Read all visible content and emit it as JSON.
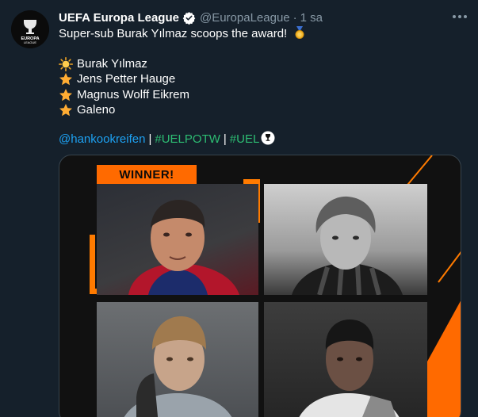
{
  "tweet": {
    "account_name": "UEFA Europa League",
    "handle": "@EuropaLeague",
    "separator": "·",
    "time": "1 sa",
    "text": "Super-sub Burak Yılmaz scoops the award!",
    "avatar_logo_text_1": "EUROPA",
    "avatar_logo_text_2": "LEAGUE",
    "nominees": [
      {
        "icon": "sun-icon",
        "name": "Burak Yılmaz"
      },
      {
        "icon": "star-icon",
        "name": "Jens Petter Hauge"
      },
      {
        "icon": "star-icon",
        "name": "Magnus Wolff Eikrem"
      },
      {
        "icon": "star-icon",
        "name": "Galeno"
      }
    ],
    "tags": {
      "mention": "@hankookreifen",
      "hashtag1": "#UELPOTW",
      "hashtag2": "#UEL",
      "pipe": "|"
    },
    "card": {
      "winner_label": "WINNER!"
    }
  },
  "colors": {
    "background": "#15202b",
    "link_blue": "#1da1f2",
    "hashtag_green": "#2dbd73",
    "accent_orange": "#ff6a00",
    "muted": "#8899a6"
  }
}
